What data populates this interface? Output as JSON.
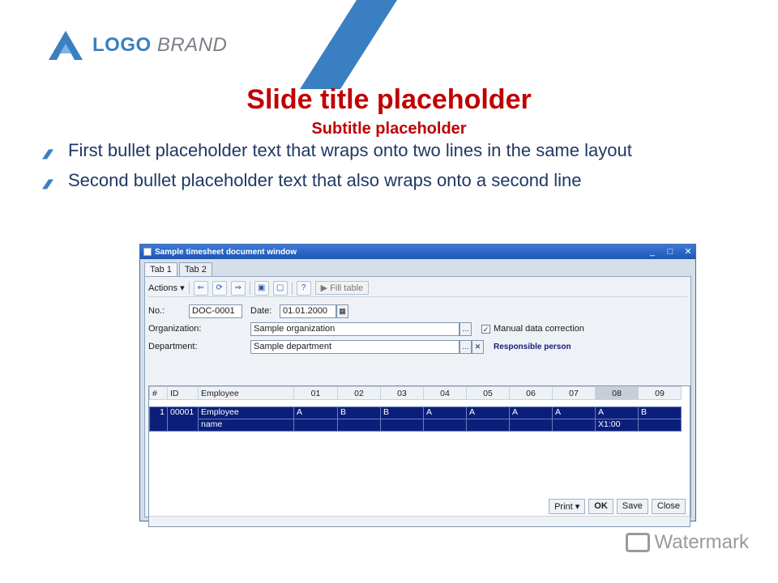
{
  "brand": {
    "name_part1": "LOGO",
    "name_part2": "BRAND",
    "accent": "#3a7fc1"
  },
  "slide": {
    "title": "Slide title placeholder",
    "subtitle": "Subtitle placeholder",
    "bullets": [
      "First bullet placeholder text that wraps onto two lines in the same layout",
      "Second bullet placeholder text that also wraps onto a second line"
    ]
  },
  "window": {
    "title": "Sample timesheet document window",
    "tabs": [
      {
        "label": "Tab 1"
      },
      {
        "label": "Tab 2"
      }
    ],
    "toolbar": {
      "actions_label": "Actions ▾",
      "fill_label": "▶ Fill table"
    },
    "form": {
      "number_label": "No.:",
      "number_value": "DOC-0001",
      "date_label": "Date:",
      "date_value": "01.01.2000",
      "org_label": "Organization:",
      "org_value": "Sample organization",
      "manual_label": "Manual data correction",
      "dept_label": "Department:",
      "dept_value": "Sample department",
      "responsible": "Responsible person"
    },
    "grid": {
      "columns": [
        "#",
        "ID",
        "Employee",
        "01",
        "02",
        "03",
        "04",
        "05",
        "06",
        "07",
        "08",
        "09"
      ],
      "rows": [
        {
          "n": "1",
          "id": "00001",
          "name_line1": "Employee",
          "name_line2": "name",
          "days": [
            "A",
            "B",
            "B",
            "A",
            "A",
            "A",
            "A",
            "A",
            "B"
          ],
          "extra": "X1:00"
        }
      ]
    },
    "footer": {
      "print": "Print ▾",
      "ok": "OK",
      "save": "Save",
      "close": "Close"
    }
  },
  "watermark": {
    "text": "Watermark"
  }
}
